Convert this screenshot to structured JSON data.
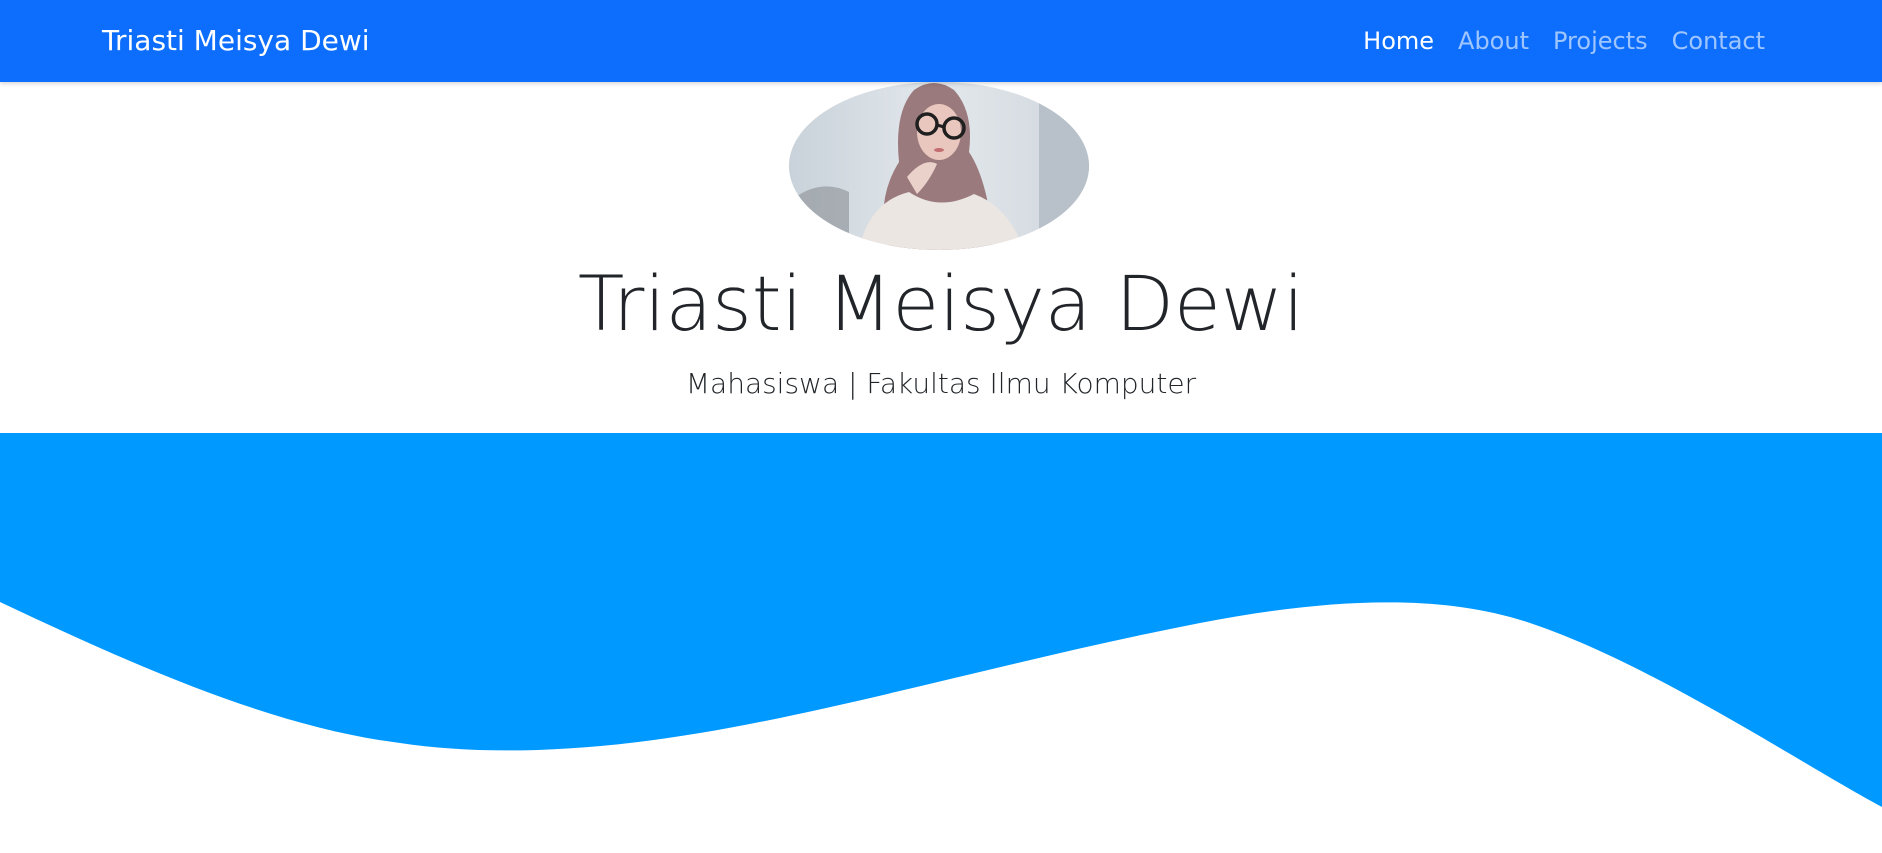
{
  "navbar": {
    "brand": "Triasti Meisya Dewi",
    "links": [
      {
        "label": "Home",
        "active": true
      },
      {
        "label": "About",
        "active": false
      },
      {
        "label": "Projects",
        "active": false
      },
      {
        "label": "Contact",
        "active": false
      }
    ]
  },
  "hero": {
    "photo_alt": "Profile photo",
    "title": "Triasti Meisya Dewi",
    "subtitle": "Mahasiswa | Fakultas Ilmu Komputer"
  },
  "colors": {
    "navbar": "#0d6efd",
    "wave": "#0099ff",
    "text": "#212529"
  }
}
